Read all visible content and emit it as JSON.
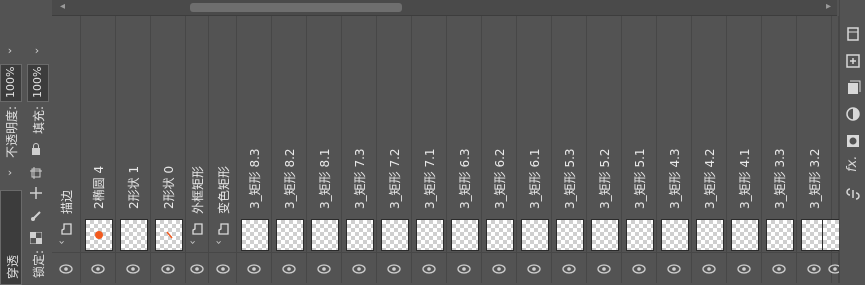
{
  "left_panel": {
    "tab_label": "穿透",
    "opacity_label": "不透明度:",
    "opacity_value": "100%",
    "fill_label": "填充:",
    "fill_value": "100%",
    "lock_label": "锁定:"
  },
  "layers": [
    {
      "name": "描边",
      "type": "group"
    },
    {
      "name": "2椭圆 4",
      "type": "ellipse"
    },
    {
      "name": "2形状 1",
      "type": "shape"
    },
    {
      "name": "2形状 0",
      "type": "shape"
    },
    {
      "name": "外框矩形",
      "type": "group"
    },
    {
      "name": "变色矩形",
      "type": "group"
    },
    {
      "name": "3_矩形 8.3",
      "type": "rect"
    },
    {
      "name": "3_矩形 8.2",
      "type": "rect"
    },
    {
      "name": "3_矩形 8.1",
      "type": "rect"
    },
    {
      "name": "3_矩形 7.3",
      "type": "rect"
    },
    {
      "name": "3_矩形 7.2",
      "type": "rect"
    },
    {
      "name": "3_矩形 7.1",
      "type": "rect"
    },
    {
      "name": "3_矩形 6.3",
      "type": "rect"
    },
    {
      "name": "3_矩形 6.2",
      "type": "rect"
    },
    {
      "name": "3_矩形 6.1",
      "type": "rect"
    },
    {
      "name": "3_矩形 5.3",
      "type": "rect"
    },
    {
      "name": "3_矩形 5.2",
      "type": "rect"
    },
    {
      "name": "3_矩形 5.1",
      "type": "rect"
    },
    {
      "name": "3_矩形 4.3",
      "type": "rect"
    },
    {
      "name": "3_矩形 4.2",
      "type": "rect"
    },
    {
      "name": "3_矩形 4.1",
      "type": "rect"
    },
    {
      "name": "3_矩形 3.3",
      "type": "rect"
    },
    {
      "name": "3_矩形 3.2",
      "type": "rect"
    },
    {
      "name": "",
      "type": "rect"
    }
  ],
  "right_tools": [
    "filter-icon",
    "new-layer-icon",
    "layer-icon",
    "adjustment-icon",
    "mask-icon",
    "fx-icon",
    "link-icon"
  ],
  "fx_label": "fx.",
  "accent_color": "#f25a1e"
}
